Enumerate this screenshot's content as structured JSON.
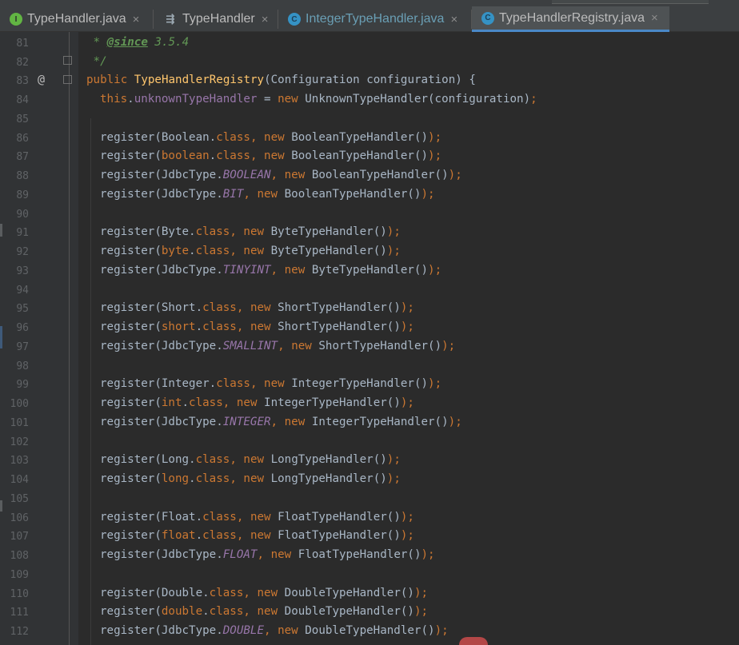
{
  "tabs": [
    {
      "icon": "interface-icon",
      "glyph": "I",
      "label": "TypeHandler.java",
      "close": "×",
      "active": false
    },
    {
      "icon": "type-hierarchy-icon",
      "glyph": "⇶",
      "label": "TypeHandler",
      "close": "×",
      "active": false
    },
    {
      "icon": "class-icon",
      "glyph": "C",
      "label": "IntegerTypeHandler.java",
      "close": "×",
      "active": false
    },
    {
      "icon": "class-icon",
      "glyph": "C",
      "label": "TypeHandlerRegistry.java",
      "close": "×",
      "active": true
    }
  ],
  "gutter": {
    "annotation_marker": "@"
  },
  "line_numbers": [
    "81",
    "82",
    "83",
    "84",
    "85",
    "86",
    "87",
    "88",
    "89",
    "90",
    "91",
    "92",
    "93",
    "94",
    "95",
    "96",
    "97",
    "98",
    "99",
    "100",
    "101",
    "102",
    "103",
    "104",
    "105",
    "106",
    "107",
    "108",
    "109",
    "110",
    "111",
    "112"
  ],
  "code": {
    "l81": {
      "star": " * ",
      "tag": "@since",
      "rest": " 3.5.4"
    },
    "l82": {
      "end": " */"
    },
    "l83": {
      "kw": "public ",
      "name": "TypeHandlerRegistry",
      "params": "(Configuration configuration) {"
    },
    "l84": {
      "this": "this",
      "dot": ".",
      "field": "unknownTypeHandler",
      "eq": " = ",
      "new": "new ",
      "ctor": "UnknownTypeHandler(configuration)",
      "semi": ";"
    },
    "l86": {
      "a": "register(Boolean.",
      "k": "class",
      "c": ", ",
      "n": "new ",
      "b": "BooleanTypeHandler()",
      "e": ");"
    },
    "l87": {
      "a": "register(",
      "k1": "boolean",
      "d": ".",
      "k": "class",
      "c": ", ",
      "n": "new ",
      "b": "BooleanTypeHandler()",
      "e": ");"
    },
    "l88": {
      "a": "register(JdbcType.",
      "cst": "BOOLEAN",
      "c": ", ",
      "n": "new ",
      "b": "BooleanTypeHandler()",
      "e": ");"
    },
    "l89": {
      "a": "register(JdbcType.",
      "cst": "BIT",
      "c": ", ",
      "n": "new ",
      "b": "BooleanTypeHandler()",
      "e": ");"
    },
    "l91": {
      "a": "register(Byte.",
      "k": "class",
      "c": ", ",
      "n": "new ",
      "b": "ByteTypeHandler()",
      "e": ");"
    },
    "l92": {
      "a": "register(",
      "k1": "byte",
      "d": ".",
      "k": "class",
      "c": ", ",
      "n": "new ",
      "b": "ByteTypeHandler()",
      "e": ");"
    },
    "l93": {
      "a": "register(JdbcType.",
      "cst": "TINYINT",
      "c": ", ",
      "n": "new ",
      "b": "ByteTypeHandler()",
      "e": ");"
    },
    "l95": {
      "a": "register(Short.",
      "k": "class",
      "c": ", ",
      "n": "new ",
      "b": "ShortTypeHandler()",
      "e": ");"
    },
    "l96": {
      "a": "register(",
      "k1": "short",
      "d": ".",
      "k": "class",
      "c": ", ",
      "n": "new ",
      "b": "ShortTypeHandler()",
      "e": ");"
    },
    "l97": {
      "a": "register(JdbcType.",
      "cst": "SMALLINT",
      "c": ", ",
      "n": "new ",
      "b": "ShortTypeHandler()",
      "e": ");"
    },
    "l99": {
      "a": "register(Integer.",
      "k": "class",
      "c": ", ",
      "n": "new ",
      "b": "IntegerTypeHandler()",
      "e": ");"
    },
    "l100": {
      "a": "register(",
      "k1": "int",
      "d": ".",
      "k": "class",
      "c": ", ",
      "n": "new ",
      "b": "IntegerTypeHandler()",
      "e": ");"
    },
    "l101": {
      "a": "register(JdbcType.",
      "cst": "INTEGER",
      "c": ", ",
      "n": "new ",
      "b": "IntegerTypeHandler()",
      "e": ");"
    },
    "l103": {
      "a": "register(Long.",
      "k": "class",
      "c": ", ",
      "n": "new ",
      "b": "LongTypeHandler()",
      "e": ");"
    },
    "l104": {
      "a": "register(",
      "k1": "long",
      "d": ".",
      "k": "class",
      "c": ", ",
      "n": "new ",
      "b": "LongTypeHandler()",
      "e": ");"
    },
    "l106": {
      "a": "register(Float.",
      "k": "class",
      "c": ", ",
      "n": "new ",
      "b": "FloatTypeHandler()",
      "e": ");"
    },
    "l107": {
      "a": "register(",
      "k1": "float",
      "d": ".",
      "k": "class",
      "c": ", ",
      "n": "new ",
      "b": "FloatTypeHandler()",
      "e": ");"
    },
    "l108": {
      "a": "register(JdbcType.",
      "cst": "FLOAT",
      "c": ", ",
      "n": "new ",
      "b": "FloatTypeHandler()",
      "e": ");"
    },
    "l110": {
      "a": "register(Double.",
      "k": "class",
      "c": ", ",
      "n": "new ",
      "b": "DoubleTypeHandler()",
      "e": ");"
    },
    "l111": {
      "a": "register(",
      "k1": "double",
      "d": ".",
      "k": "class",
      "c": ", ",
      "n": "new ",
      "b": "DoubleTypeHandler()",
      "e": ");"
    },
    "l112": {
      "a": "register(JdbcType.",
      "cst": "DOUBLE",
      "c": ", ",
      "n": "new ",
      "b": "DoubleTypeHandler()",
      "e": ");"
    }
  },
  "colors": {
    "background": "#2b2b2b",
    "keyword": "#cc7832",
    "field": "#9876aa",
    "method_decl": "#ffc66d",
    "doc_comment": "#629755",
    "text": "#a9b7c6",
    "active_tab_underline": "#4a88c7"
  }
}
